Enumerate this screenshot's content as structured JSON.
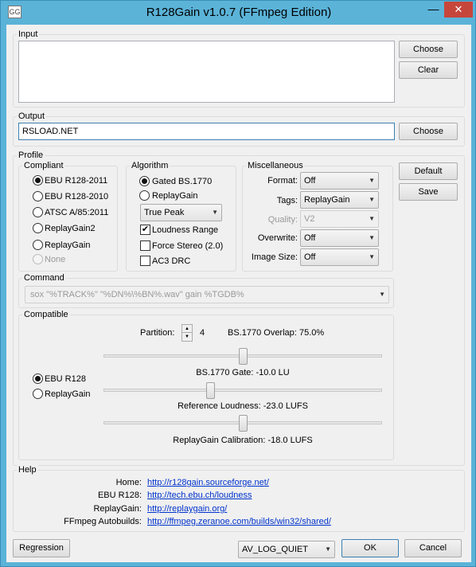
{
  "window": {
    "title": "R128Gain v1.0.7 (FFmpeg Edition)",
    "minimize_glyph": "—",
    "close_glyph": "✕",
    "icon": "app-icon"
  },
  "input": {
    "label": "Input",
    "value": "",
    "choose": "Choose",
    "clear": "Clear"
  },
  "output": {
    "label": "Output",
    "value": "RSLOAD.NET",
    "choose": "Choose"
  },
  "profile": {
    "label": "Profile",
    "compliant": {
      "label": "Compliant",
      "options": [
        "EBU R128-2011",
        "EBU R128-2010",
        "ATSC A/85:2011",
        "ReplayGain2",
        "ReplayGain",
        "None"
      ],
      "selected": "EBU R128-2011"
    },
    "algorithm": {
      "label": "Algorithm",
      "options": [
        "Gated BS.1770",
        "ReplayGain"
      ],
      "selected": "Gated BS.1770",
      "peak": "True Peak",
      "loudness_range": "Loudness Range",
      "loudness_range_checked": true,
      "force_stereo": "Force Stereo (2.0)",
      "force_stereo_checked": false,
      "ac3_drc": "AC3 DRC",
      "ac3_drc_checked": false
    },
    "misc": {
      "label": "Miscellaneous",
      "format_label": "Format:",
      "format_value": "Off",
      "tags_label": "Tags:",
      "tags_value": "ReplayGain",
      "quality_label": "Quality:",
      "quality_value": "V2",
      "overwrite_label": "Overwrite:",
      "overwrite_value": "Off",
      "image_size_label": "Image Size:",
      "image_size_value": "Off"
    },
    "default_btn": "Default",
    "save_btn": "Save",
    "command": {
      "label": "Command",
      "value": "sox \"%TRACK%\" \"%DN%\\%BN%.wav\" gain %TGDB%"
    },
    "compatible": {
      "label": "Compatible",
      "partition_label": "Partition:",
      "partition_value": "4",
      "overlap_label": "BS.1770 Overlap:",
      "overlap_value": "75.0%",
      "gate_label": "BS.1770 Gate: -10.0 LU",
      "gate_level": 0.5,
      "ref_label": "Reference Loudness: -23.0 LUFS",
      "ref_level": 0.38,
      "cal_label": "ReplayGain Calibration: -18.0 LUFS",
      "cal_level": 0.5,
      "options": [
        "EBU R128",
        "ReplayGain"
      ],
      "selected": "EBU R128"
    }
  },
  "help": {
    "label": "Help",
    "rows": [
      {
        "label": "Home:",
        "link": "http://r128gain.sourceforge.net/"
      },
      {
        "label": "EBU R128:",
        "link": "http://tech.ebu.ch/loudness"
      },
      {
        "label": "ReplayGain:",
        "link": "http://replaygain.org/"
      },
      {
        "label": "FFmpeg Autobuilds:",
        "link": "http://ffmpeg.zeranoe.com/builds/win32/shared/"
      }
    ]
  },
  "footer": {
    "regression": "Regression",
    "log_level": "AV_LOG_QUIET",
    "ok": "OK",
    "cancel": "Cancel"
  }
}
